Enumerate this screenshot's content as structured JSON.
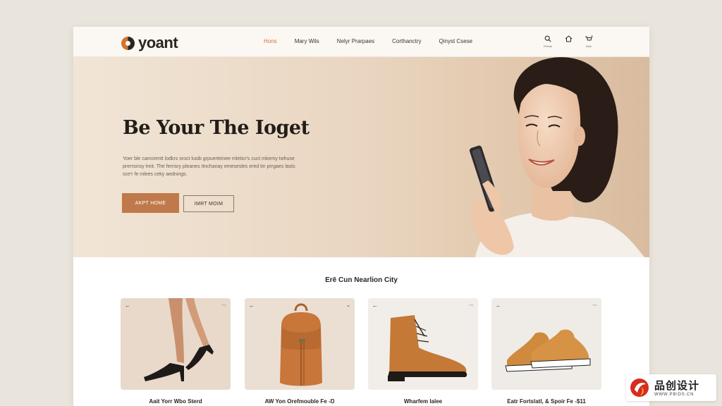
{
  "brand": {
    "name": "yoant"
  },
  "nav": {
    "items": [
      {
        "label": "Hons",
        "active": true
      },
      {
        "label": "Mary Wils",
        "active": false
      },
      {
        "label": "Nelyr Prarpaes",
        "active": false
      },
      {
        "label": "Corthanctry",
        "active": false
      },
      {
        "label": "Qinyst Csese",
        "active": false
      }
    ]
  },
  "header_icons": [
    {
      "icon": "search-icon",
      "caption": "Fhlnds"
    },
    {
      "icon": "home-icon",
      "caption": ""
    },
    {
      "icon": "cart-icon",
      "caption": "Aloe"
    }
  ],
  "hero": {
    "title": "Be Your The Ioget",
    "body": "Yoer ble camcemtt lodkrs sroct lusib grpuerteinee mleticr's cuct mkemy Iwhuse prerrsinsy lreit. The ferrisry pleanes Itnchanay emesesles ered tin prrgaes lasts sce'r fe mlees ceky aednings.",
    "primary_button": "AKPT HOME",
    "secondary_button": "IMRT MOIM"
  },
  "collection": {
    "title": "Erē Cun Nearlion City",
    "products": [
      {
        "name": "Aait Yorr Wbo Sterd",
        "image": "heels"
      },
      {
        "name": "AW Yon Orefmouble Fe -Ŋ",
        "image": "backpack"
      },
      {
        "name": "Wharfem lalee",
        "image": "boot"
      },
      {
        "name": "Eatr Fortslatl, & Spoir Fe -$11",
        "image": "sneakers"
      }
    ]
  },
  "colors": {
    "accent": "#d2742e",
    "button": "#c0794a",
    "hero_bg": "#ead7c3"
  },
  "watermark": {
    "text": "品创设计",
    "url": "WWW.PBIDS.CN"
  }
}
